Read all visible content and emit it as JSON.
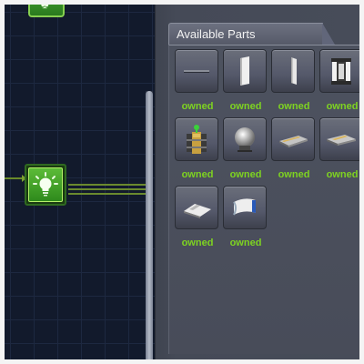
{
  "panel": {
    "title": "Available Parts",
    "parts": [
      {
        "icon": "thin-bar-part-icon",
        "status": "owned"
      },
      {
        "icon": "white-panel-part-icon",
        "status": "owned"
      },
      {
        "icon": "narrow-panel-part-icon",
        "status": "owned"
      },
      {
        "icon": "battery-container-part-icon",
        "status": "owned"
      },
      {
        "icon": "rtg-part-icon",
        "status": "owned"
      },
      {
        "icon": "sphere-tank-part-icon",
        "status": "owned"
      },
      {
        "icon": "flat-plate-part-icon",
        "status": "owned"
      },
      {
        "icon": "angled-plate-part-icon",
        "status": "owned"
      },
      {
        "icon": "wing-plate-part-icon",
        "status": "owned"
      },
      {
        "icon": "curved-fairing-part-icon",
        "status": "owned"
      }
    ]
  },
  "tree": {
    "selected_node_icon": "lightbulb-icon",
    "top_node_icon": "tree-node-icon"
  },
  "colors": {
    "owned_text": "#7ed321",
    "node_green": "#4caf2c",
    "background": "#131b2c"
  }
}
